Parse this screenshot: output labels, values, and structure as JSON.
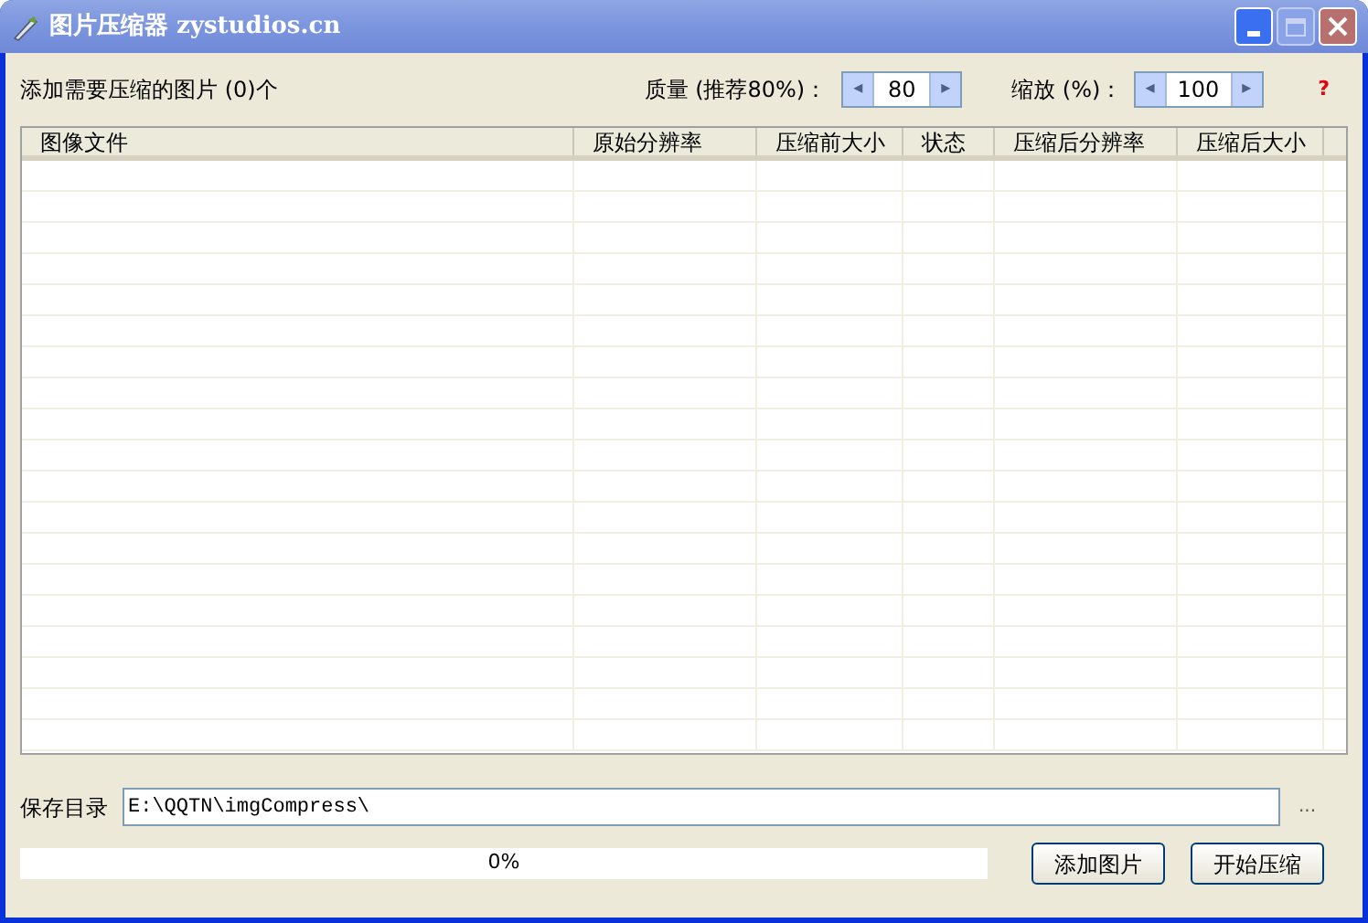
{
  "window": {
    "title": "图片压缩器 zystudios.cn"
  },
  "header": {
    "count_label": "添加需要压缩的图片 (0)个",
    "quality": {
      "label": "质量 (推荐80%)：",
      "value": "80",
      "left": "◂",
      "right": "▸"
    },
    "scale": {
      "label": "缩放 (%)：",
      "value": "100",
      "left": "◂",
      "right": "▸"
    },
    "help": "?"
  },
  "table": {
    "columns": [
      "图像文件",
      "原始分辨率",
      "压缩前大小",
      "状态",
      "压缩后分辨率",
      "压缩后大小"
    ]
  },
  "save": {
    "label": "保存目录",
    "value": "E:\\QQTN\\imgCompress\\",
    "browse": "..."
  },
  "progress": {
    "level": 0,
    "text": "0%"
  },
  "buttons": [
    "添加图片",
    "开始压缩"
  ]
}
